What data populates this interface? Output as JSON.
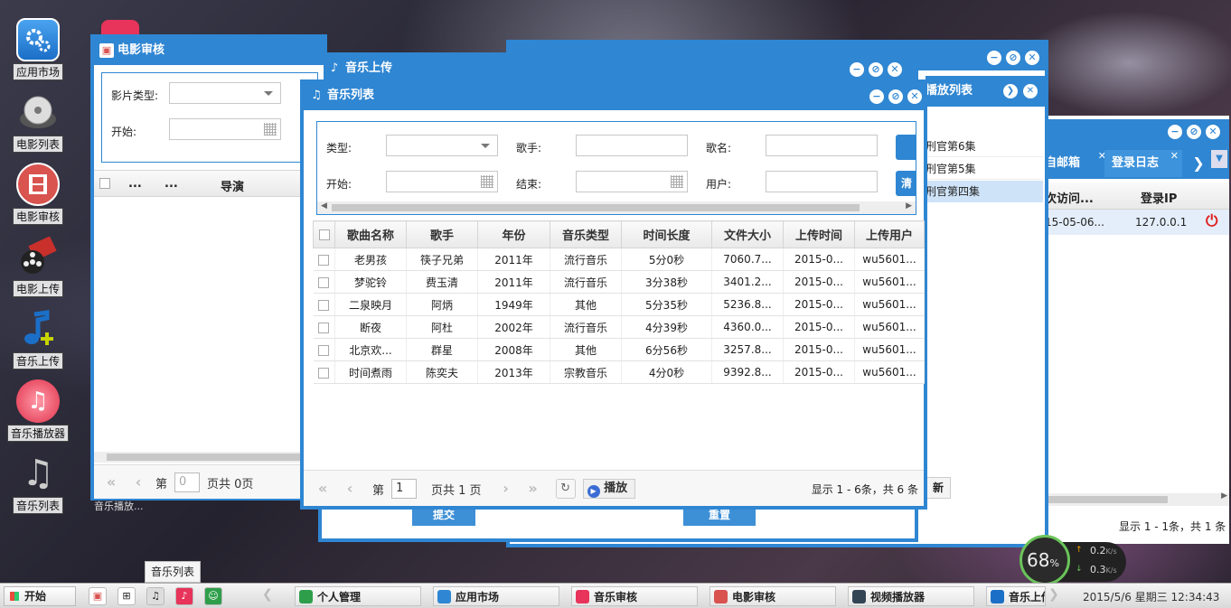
{
  "desktop": {
    "icons": [
      {
        "label": "应用市场"
      },
      {
        "label": "电影列表"
      },
      {
        "label": "电影审核"
      },
      {
        "label": "电影上传"
      },
      {
        "label": "音乐上传"
      },
      {
        "label": "音乐播放器"
      },
      {
        "label": "音乐列表"
      }
    ]
  },
  "movie_review": {
    "title": "电影审核",
    "type_label": "影片类型:",
    "start_label": "开始:",
    "columns": [
      "...",
      "...",
      "导演"
    ],
    "pager": {
      "page_label": "第",
      "page_value": "0",
      "total": "页共 0页"
    },
    "taskbar_tail": "音乐播放..."
  },
  "music_upload": {
    "title": "音乐上传",
    "submit_label": "提交",
    "reset_label": "重置"
  },
  "playlist": {
    "title": "播放列表",
    "items": [
      "刑官第6集",
      "刑官第5集",
      "刑官第四集"
    ]
  },
  "personal": {
    "tabs": [
      "自邮箱",
      "登录日志"
    ],
    "columns": [
      "次访问...",
      "登录IP"
    ],
    "row": {
      "time": "15-05-06...",
      "ip": "127.0.0.1"
    },
    "tail_btn": "新",
    "status": "显示 1 - 1条，共 1 条"
  },
  "music_list": {
    "title": "音乐列表",
    "search": {
      "type_label": "类型:",
      "singer_label": "歌手:",
      "song_label": "歌名:",
      "start_label": "开始:",
      "end_label": "结束:",
      "user_label": "用户:",
      "type_value": "",
      "singer_value": "",
      "song_value": "",
      "user_value": "",
      "btn2": "清"
    },
    "columns": [
      "歌曲名称",
      "歌手",
      "年份",
      "音乐类型",
      "时间长度",
      "文件大小",
      "上传时间",
      "上传用户"
    ],
    "rows": [
      [
        "老男孩",
        "筷子兄弟",
        "2011年",
        "流行音乐",
        "5分0秒",
        "7060.7...",
        "2015-0...",
        "wu5601..."
      ],
      [
        "梦驼铃",
        "费玉清",
        "2011年",
        "流行音乐",
        "3分38秒",
        "3401.2...",
        "2015-0...",
        "wu5601..."
      ],
      [
        "二泉映月",
        "阿炳",
        "1949年",
        "其他",
        "5分35秒",
        "5236.8...",
        "2015-0...",
        "wu5601..."
      ],
      [
        "断夜",
        "阿杜",
        "2002年",
        "流行音乐",
        "4分39秒",
        "4360.0...",
        "2015-0...",
        "wu5601..."
      ],
      [
        "北京欢...",
        "群星",
        "2008年",
        "其他",
        "6分56秒",
        "3257.8...",
        "2015-0...",
        "wu5601..."
      ],
      [
        "时间煮雨",
        "陈奕夫",
        "2013年",
        "宗教音乐",
        "4分0秒",
        "9392.8...",
        "2015-0...",
        "wu5601..."
      ]
    ],
    "pager": {
      "page_label": "第",
      "page_value": "1",
      "total": "页共 1 页",
      "play_label": "播放",
      "status": "显示 1 - 6条，共 6 条"
    }
  },
  "tooltip": "音乐列表",
  "netmon": {
    "percent": "68",
    "unit": "%",
    "up": "0.2",
    "down": "0.3",
    "rate_unit": "K/s"
  },
  "taskbar": {
    "start": "开始",
    "items": [
      "个人管理",
      "应用市场",
      "音乐审核",
      "电影审核",
      "视频播放器",
      "音乐上传"
    ],
    "clock": "2015/5/6 星期三 12:34:43"
  }
}
